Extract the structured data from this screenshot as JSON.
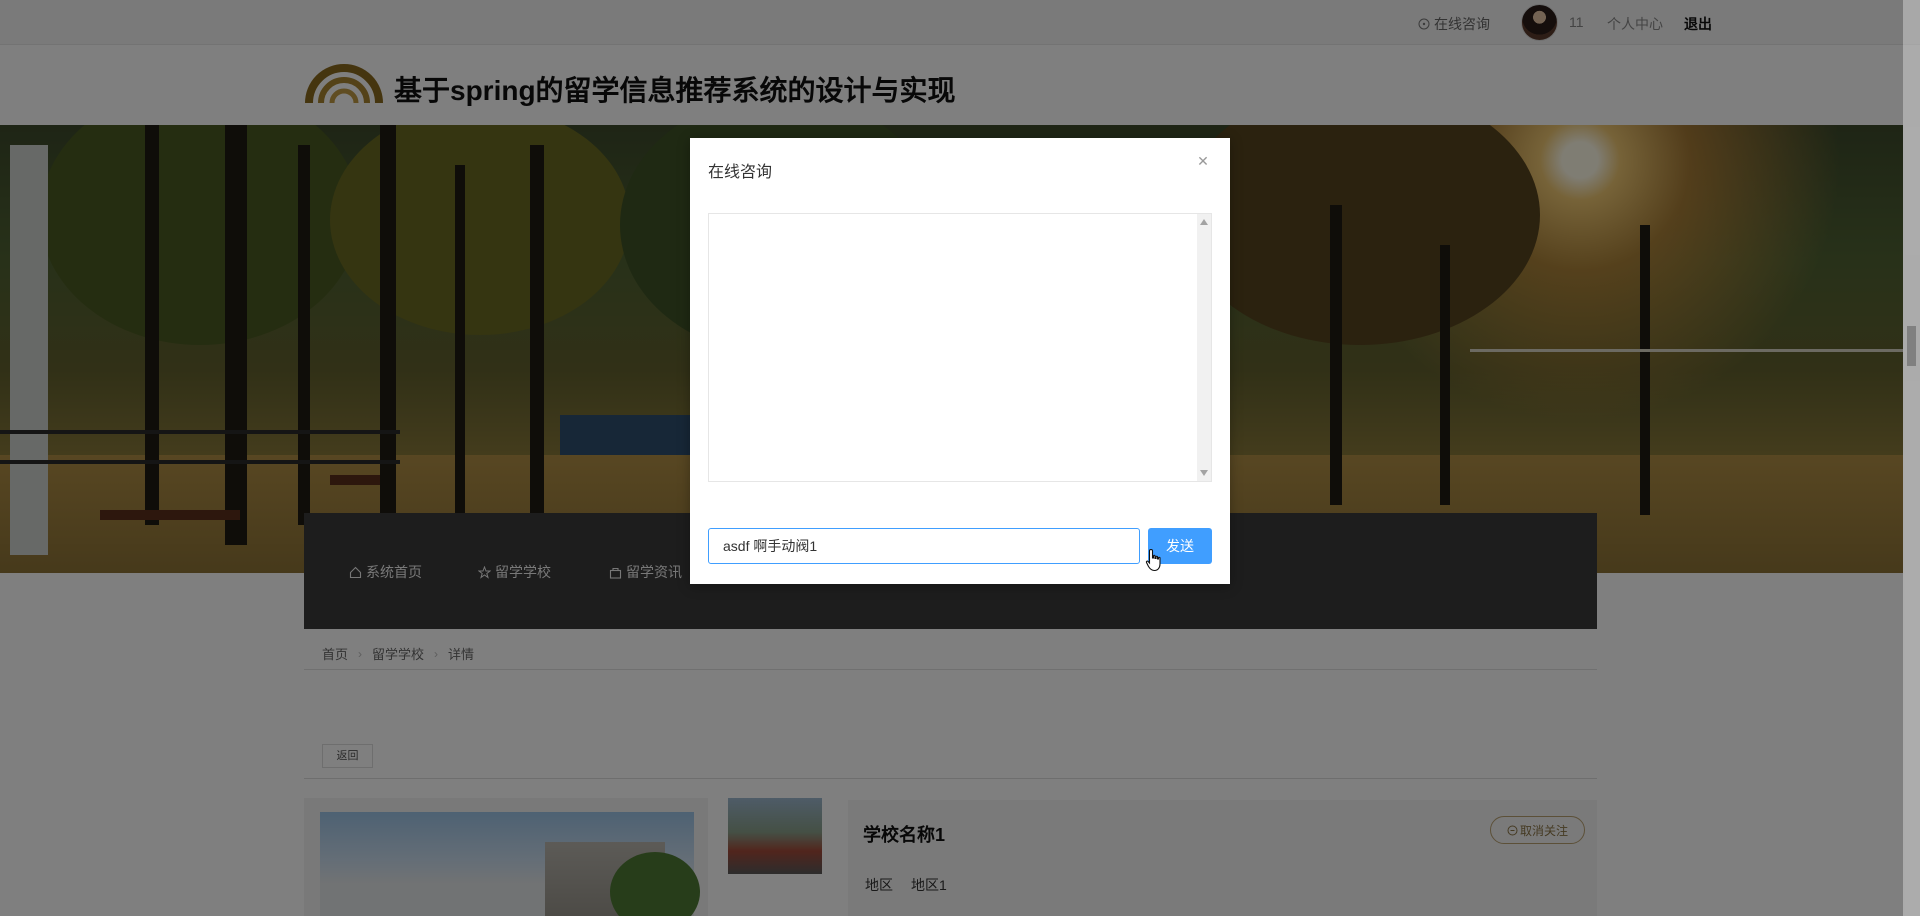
{
  "topbar": {
    "consult_label": "在线咨询",
    "username": "11",
    "personal_center_label": "个人中心",
    "logout_label": "退出"
  },
  "header": {
    "title": "基于spring的留学信息推荐系统的设计与实现"
  },
  "nav": {
    "items": [
      {
        "label": "系统首页",
        "icon": "home-icon"
      },
      {
        "label": "留学学校",
        "icon": "star-icon"
      },
      {
        "label": "留学资讯",
        "icon": "bag-icon"
      }
    ]
  },
  "breadcrumb": [
    "首页",
    "留学学校",
    "详情"
  ],
  "detail": {
    "back_label": "返回",
    "school_name": "学校名称1",
    "unfollow_label": "取消关注",
    "region_label": "地区",
    "region_value": "地区1"
  },
  "modal": {
    "title": "在线咨询",
    "input_value": "asdf 啊手动阀1",
    "send_label": "发送"
  },
  "colors": {
    "primary": "#409eff",
    "nav_bg": "#3a3a3a",
    "accent_gold": "#b8a070",
    "overlay": "rgba(0,0,0,0.5)"
  }
}
